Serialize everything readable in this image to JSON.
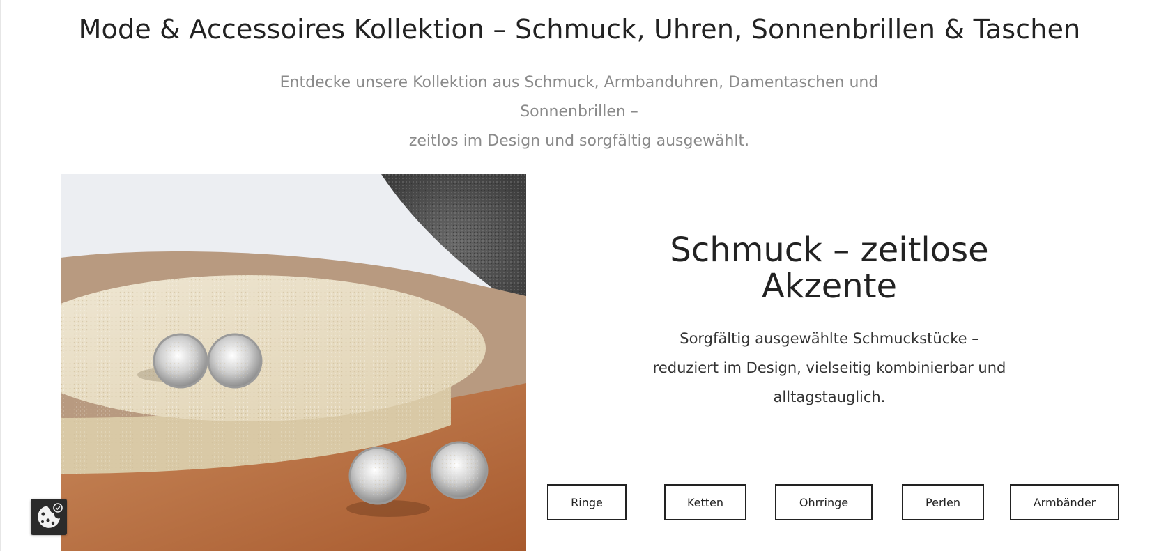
{
  "header": {
    "title": "Mode & Accessoires Kollektion – Schmuck, Uhren, Sonnenbrillen & Taschen",
    "subtitle_line1": "Entdecke unsere Kollektion aus Schmuck, Armbanduhren, Damentaschen und Sonnenbrillen –",
    "subtitle_line2": "zeitlos im Design und sorgfältig ausgewählt."
  },
  "section": {
    "title_line1": "Schmuck – zeitlose",
    "title_line2": "Akzente",
    "desc_line1": "Sorgfältig ausgewählte Schmuckstücke –",
    "desc_line2": "reduziert im Design, vielseitig kombinierbar und",
    "desc_line3": "alltagstauglich."
  },
  "categories": [
    "Ringe",
    "Ketten",
    "Ohrringe",
    "Perlen",
    "Armbänder"
  ],
  "icons": {
    "cookie": "cookie-settings-icon"
  },
  "colors": {
    "text": "#222222",
    "subtitle": "#8a8a8a",
    "cookie_bg": "#2b2b2b"
  }
}
